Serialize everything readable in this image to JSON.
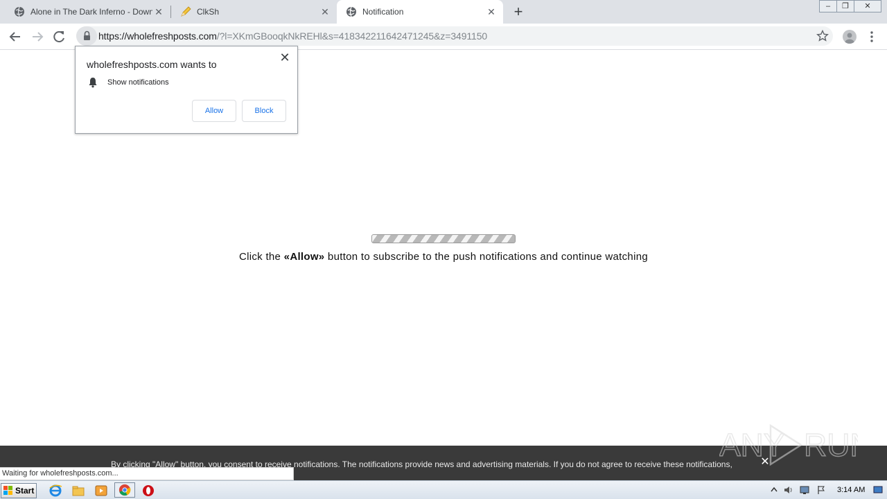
{
  "tabs": [
    {
      "title": "Alone in The Dark Inferno - Downloa",
      "favicon": "globe-icon"
    },
    {
      "title": "ClkSh",
      "favicon": "pencil-icon"
    },
    {
      "title": "Notification",
      "favicon": "globe-icon",
      "active": true
    }
  ],
  "toolbar": {
    "url_host": "https://wholefreshposts.com",
    "url_rest": "/?l=XKmGBooqkNkREHl&s=418342211642471245&z=3491150"
  },
  "permission_popup": {
    "heading": "wholefreshposts.com wants to",
    "permission": "Show notifications",
    "allow_label": "Allow",
    "block_label": "Block"
  },
  "page": {
    "message_before": "Click the ",
    "message_bold": "«Allow»",
    "message_after": " button to subscribe to the push notifications and continue watching"
  },
  "consent_bar": {
    "text": "By clicking \"Allow\" button, you consent to receive notifications. The notifications provide news and advertising materials. If you do not agree to receive these notifications,"
  },
  "status_bubble": "Waiting for wholefreshposts.com...",
  "watermark": "ANY RUN",
  "taskbar": {
    "start_label": "Start",
    "clock": "3:14 AM"
  },
  "colors": {
    "accent_blue": "#1a73e8",
    "tabstrip": "#dee1e6",
    "consent_bg": "#3a3a3a"
  }
}
